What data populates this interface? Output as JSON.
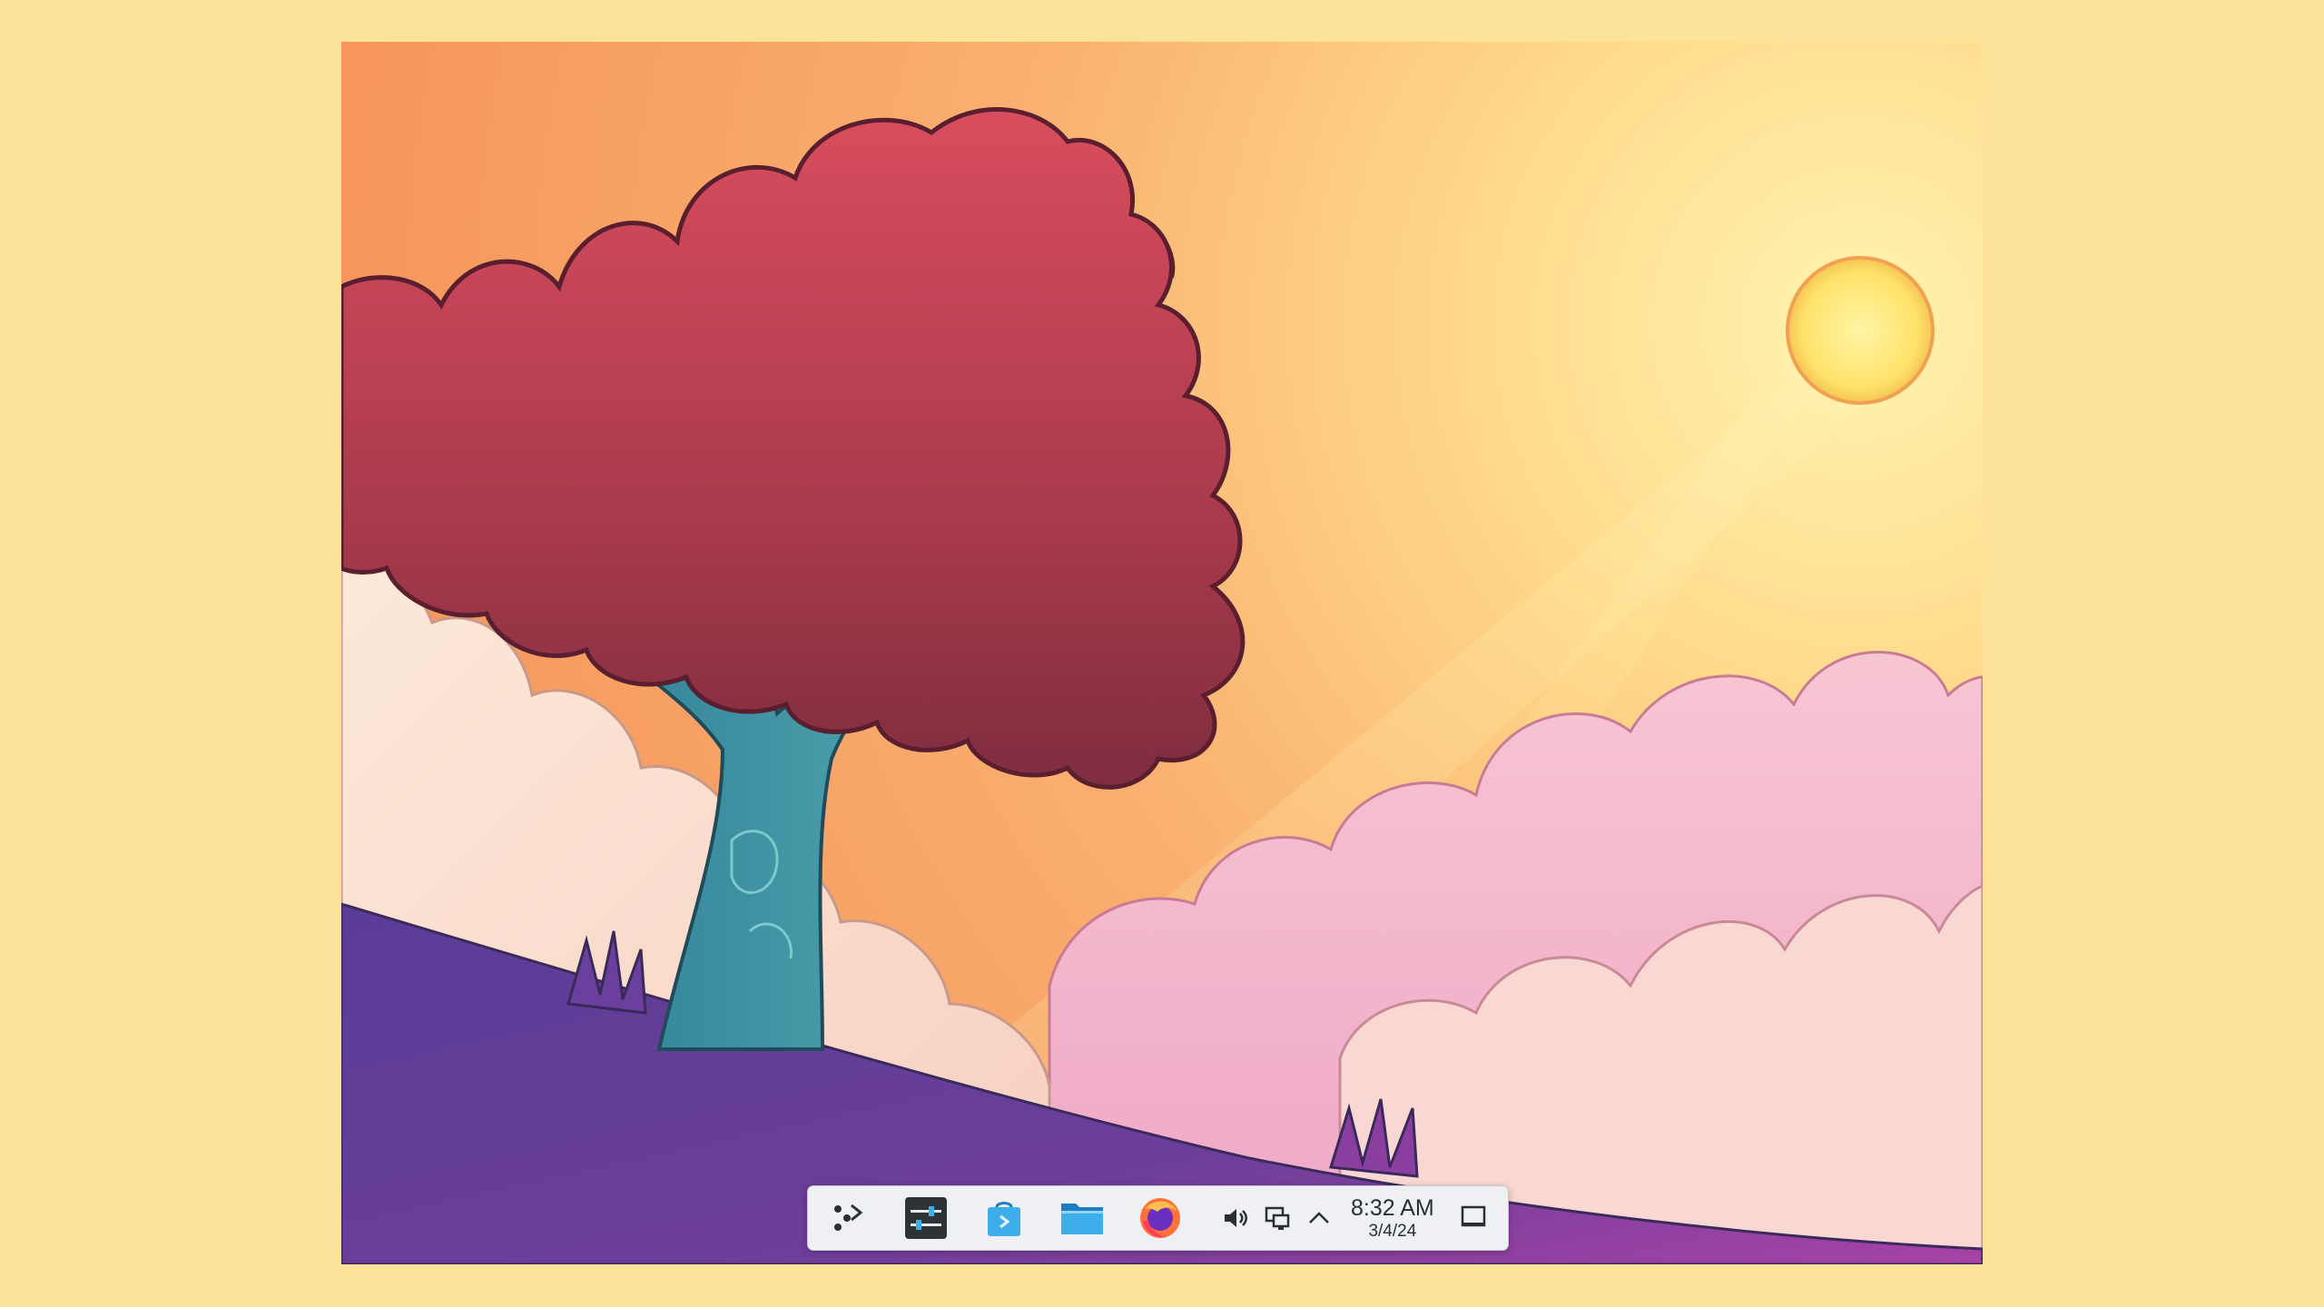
{
  "desktop": {
    "wallpaper_icon": "sunset-tree-wallpaper"
  },
  "taskbar": {
    "launchers": [
      {
        "name": "application-launcher",
        "icon": "plasma-launcher-icon"
      },
      {
        "name": "system-settings",
        "icon": "settings-sliders-icon"
      },
      {
        "name": "discover",
        "icon": "store-bag-icon"
      },
      {
        "name": "dolphin-file-manager",
        "icon": "folder-icon"
      },
      {
        "name": "firefox",
        "icon": "firefox-icon"
      }
    ],
    "tray": {
      "icons": [
        "volume-icon",
        "network-icon",
        "expand-arrow-icon"
      ]
    },
    "clock": {
      "time": "8:32 AM",
      "date": "3/4/24"
    },
    "show_desktop_icon": "show-desktop-icon"
  },
  "colors": {
    "background": "#fde39a",
    "panel": "#eef0f3",
    "accent_blue": "#3daee9"
  }
}
